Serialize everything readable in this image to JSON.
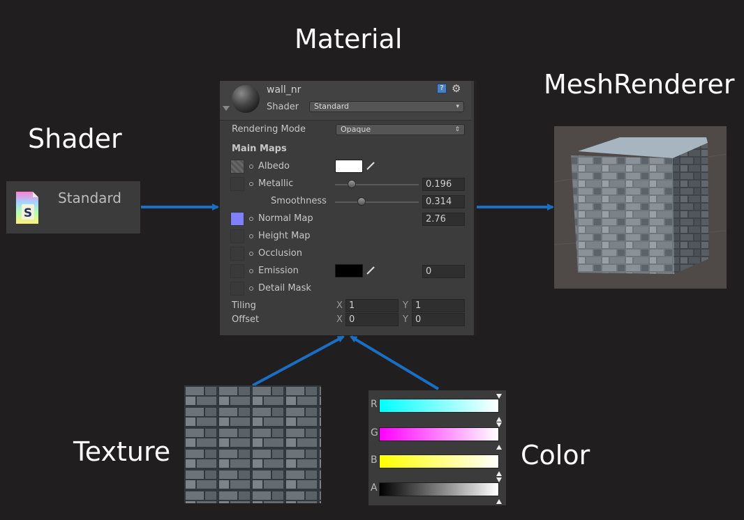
{
  "labels": {
    "material": "Material",
    "shader": "Shader",
    "mesh_renderer": "MeshRenderer",
    "texture": "Texture",
    "color": "Color"
  },
  "shader_box": {
    "name": "Standard",
    "icon": "shader-file-icon"
  },
  "material_panel": {
    "name": "wall_nr",
    "shader_label": "Shader",
    "shader_value": "Standard",
    "rendering_mode_label": "Rendering Mode",
    "rendering_mode_value": "Opaque",
    "section_title": "Main Maps",
    "albedo_label": "Albedo",
    "metallic_label": "Metallic",
    "metallic_value": "0.196",
    "metallic_level": 0.196,
    "smoothness_label": "Smoothness",
    "smoothness_value": "0.314",
    "smoothness_level": 0.314,
    "normal_map_label": "Normal Map",
    "normal_map_value": "2.76",
    "height_map_label": "Height Map",
    "occlusion_label": "Occlusion",
    "emission_label": "Emission",
    "emission_value": "0",
    "detail_mask_label": "Detail Mask",
    "tiling_label": "Tiling",
    "offset_label": "Offset",
    "x_label": "X",
    "y_label": "Y",
    "tiling_x": "1",
    "tiling_y": "1",
    "offset_x": "0",
    "offset_y": "0",
    "colors": {
      "albedo": "#ffffff",
      "emission": "#000000",
      "normal_map_slot": "#8080ff"
    }
  },
  "color_picker": {
    "channels": [
      {
        "label": "R",
        "color": "#00ffff"
      },
      {
        "label": "G",
        "color": "#ff00ff"
      },
      {
        "label": "B",
        "color": "#ffff00"
      },
      {
        "label": "A",
        "color": "#000000"
      }
    ]
  },
  "arrow_color": "#1a6fc4"
}
